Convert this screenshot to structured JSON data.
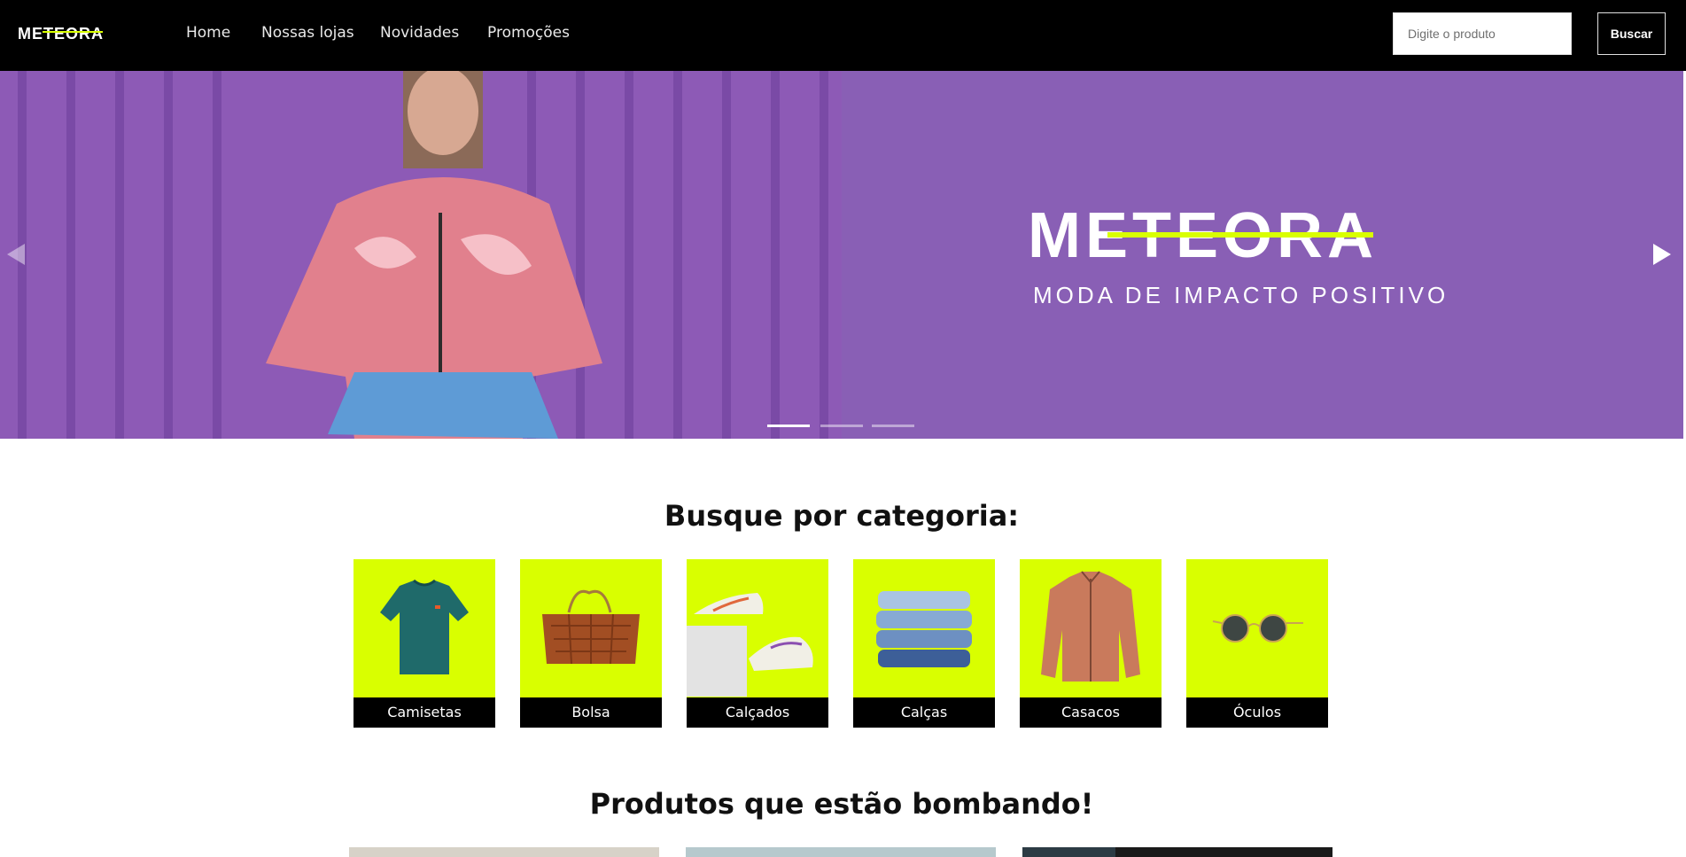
{
  "brand": {
    "name": "METEORA",
    "tagline": "MODA DE IMPACTO POSITIVO",
    "accent": "#d9ff00",
    "hero_bg": "#895fb5"
  },
  "nav": {
    "links": [
      "Home",
      "Nossas lojas",
      "Novidades",
      "Promoções"
    ]
  },
  "search": {
    "placeholder": "Digite o produto",
    "button_label": "Buscar"
  },
  "carousel": {
    "slide_count": 3,
    "active_slide": 1
  },
  "categories": {
    "title": "Busque por categoria:",
    "items": [
      {
        "label": "Camisetas",
        "icon": "tshirt"
      },
      {
        "label": "Bolsa",
        "icon": "handbag"
      },
      {
        "label": "Calçados",
        "icon": "sneakers"
      },
      {
        "label": "Calças",
        "icon": "jeans"
      },
      {
        "label": "Casacos",
        "icon": "jacket"
      },
      {
        "label": "Óculos",
        "icon": "sunglasses"
      }
    ]
  },
  "products": {
    "title": "Produtos que estão bombando!"
  }
}
